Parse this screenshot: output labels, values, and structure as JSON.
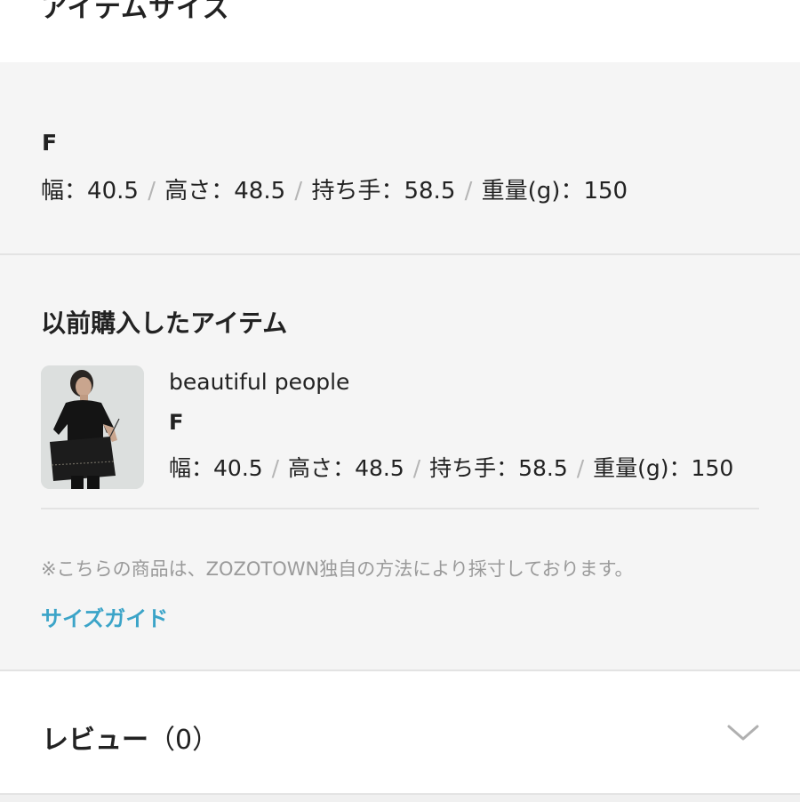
{
  "header": {
    "title": "アイテムサイズ",
    "collapse_icon": "chevron-up-icon"
  },
  "size": {
    "label": "F",
    "measurements": [
      {
        "name": "幅",
        "value": "40.5"
      },
      {
        "name": "高さ",
        "value": "48.5"
      },
      {
        "name": "持ち手",
        "value": "58.5"
      },
      {
        "name": "重量(g)",
        "value": "150"
      }
    ]
  },
  "previous": {
    "title": "以前購入したアイテム",
    "item": {
      "brand": "beautiful people",
      "size": "F",
      "measurements": [
        {
          "name": "幅",
          "value": "40.5"
        },
        {
          "name": "高さ",
          "value": "48.5"
        },
        {
          "name": "持ち手",
          "value": "58.5"
        },
        {
          "name": "重量(g)",
          "value": "150"
        }
      ]
    }
  },
  "note": "※こちらの商品は、ZOZOTOWN独自の方法により採寸しております。",
  "size_guide_link": "サイズガイド",
  "review": {
    "label": "レビュー",
    "count": "（0）",
    "expand_icon": "chevron-down-icon"
  },
  "colors": {
    "link": "#3ba4c8",
    "text": "#222222",
    "muted": "#9a9a9a",
    "separator": "#b5b5b5",
    "background": "#f5f5f5"
  }
}
